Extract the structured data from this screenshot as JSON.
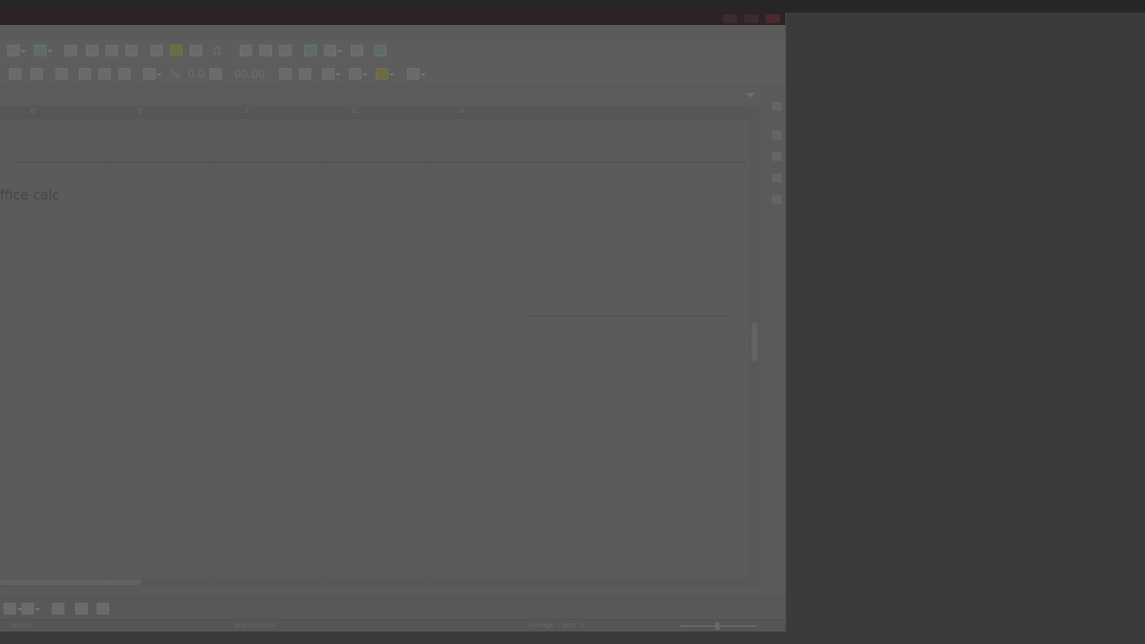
{
  "cell": {
    "visible_text": "ffice calc"
  },
  "columns": [
    "D",
    "E",
    "F",
    "G",
    "H"
  ],
  "toolbar": {
    "percent_label": "%",
    "decimal_label": "0.0",
    "currency_label": "00.00",
    "special_char_label": "Ω"
  },
  "statusbar": {
    "page_style": "Default",
    "language": "English (USA)",
    "summary": "Average: ; Sum: 0"
  },
  "colors": {
    "desktop_bg": "#3a3a3a",
    "titlebar": "#2d2324",
    "dimmed_window": "#5a5a5a"
  }
}
